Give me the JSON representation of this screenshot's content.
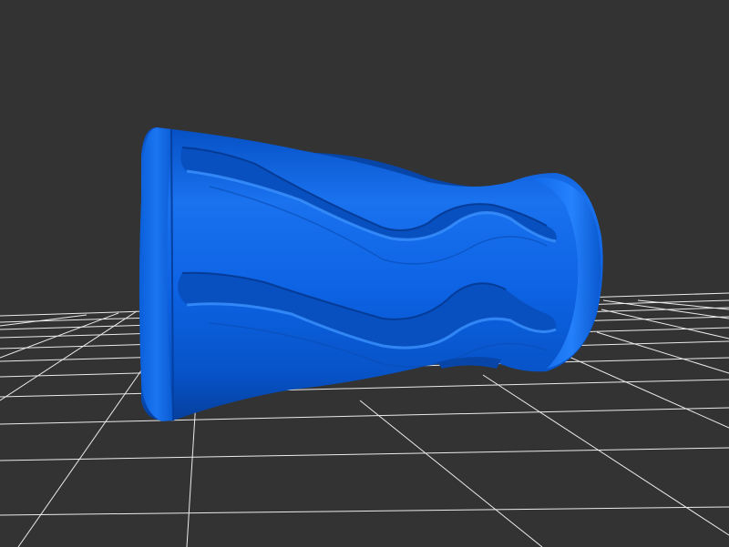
{
  "viewer": {
    "background_color": "#333333",
    "grid_color": "#ffffff",
    "model_color": "#0a63e0",
    "model_highlight_color": "#2f86ff",
    "model_shadow_color": "#0641a3",
    "model_name": "",
    "grid_visible": true
  }
}
